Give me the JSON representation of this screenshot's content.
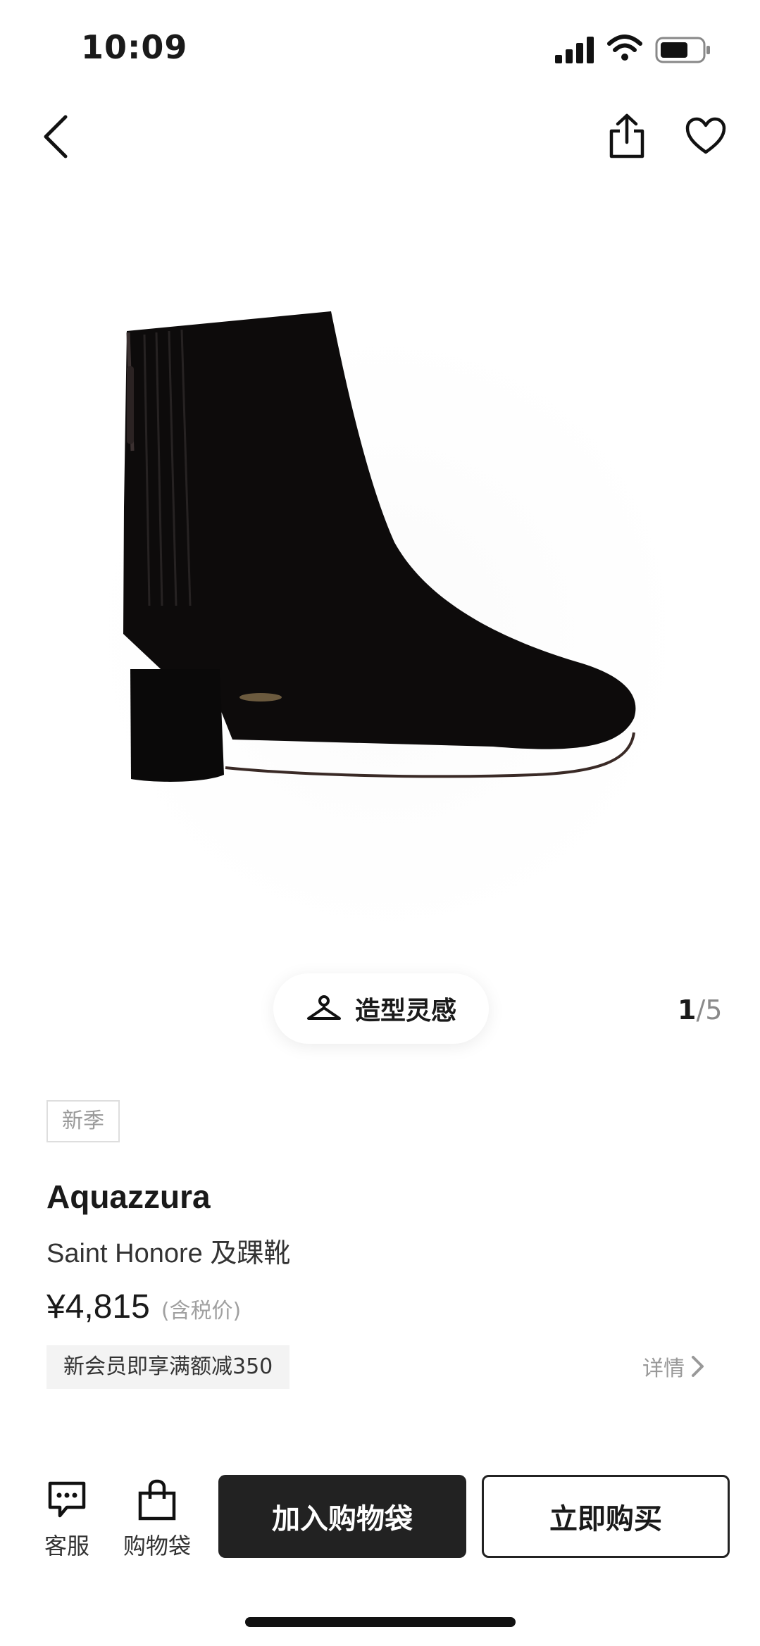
{
  "status_bar": {
    "time": "10:09"
  },
  "pager": {
    "current": "1",
    "separator": "/",
    "total": "5"
  },
  "inspiration_button": {
    "label": "造型灵感"
  },
  "badge": "新季",
  "product": {
    "brand": "Aquazzura",
    "name": "Saint Honore 及踝靴",
    "price": "¥4,815",
    "tax_note": "(含税价)"
  },
  "promo": {
    "text": "新会员即享满额减350",
    "details_label": "详情"
  },
  "bottom_bar": {
    "service_label": "客服",
    "bag_label": "购物袋",
    "add_to_bag_label": "加入购物袋",
    "buy_now_label": "立即购买"
  },
  "colors": {
    "accent": "#222222",
    "muted": "#999999",
    "promo_bg": "#f3f3f3"
  },
  "icons": [
    "signal-icon",
    "wifi-icon",
    "battery-icon",
    "back-icon",
    "share-icon",
    "heart-icon",
    "hanger-icon",
    "chevron-right-icon",
    "chat-icon",
    "shopping-bag-icon"
  ]
}
